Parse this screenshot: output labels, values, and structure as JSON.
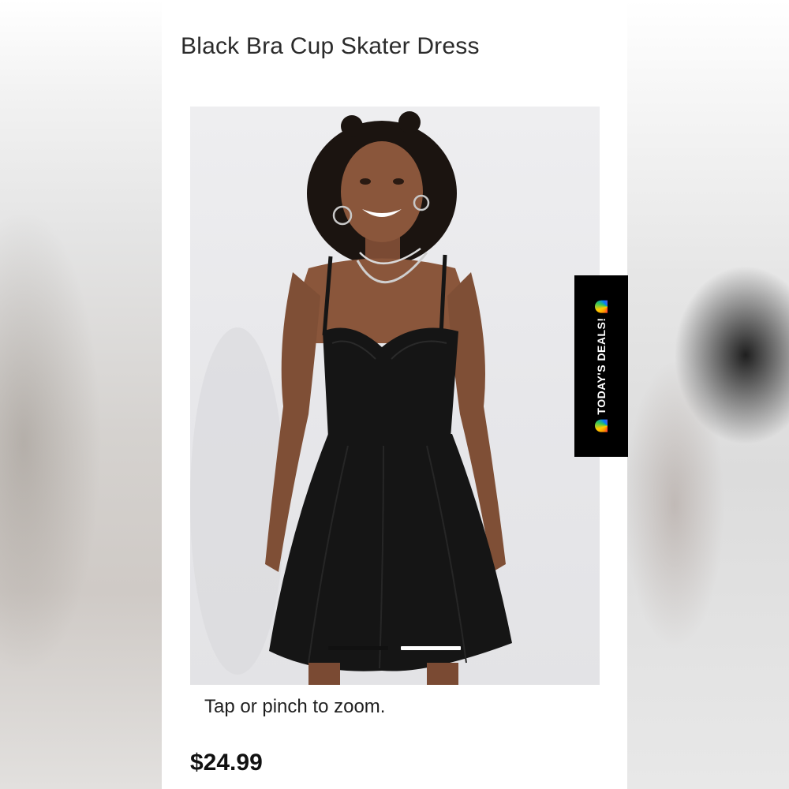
{
  "product": {
    "title": "Black Bra Cup Skater Dress",
    "image_alt": "Model wearing black bra cup skater dress",
    "zoom_hint": "Tap or pinch to zoom.",
    "price": "$24.99",
    "carousel": {
      "total": 2,
      "active_index": 0
    }
  },
  "promo": {
    "label": "TODAY'S DEALS!",
    "icon": "rainbow-icon"
  },
  "colors": {
    "background": "#ffffff",
    "promo_bg": "#000000",
    "dress": "#151515",
    "text": "#2b2b2b"
  }
}
